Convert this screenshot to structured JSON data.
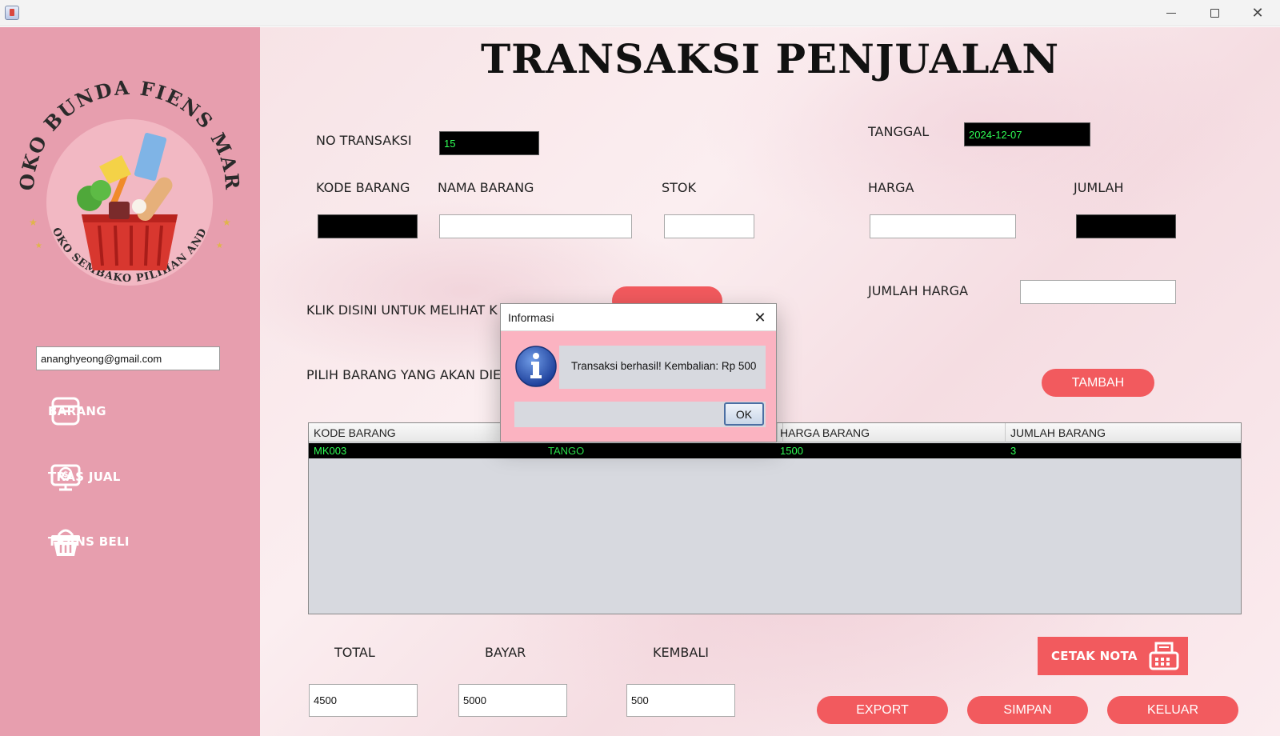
{
  "main": {
    "title": "TRANSAKSI PENJUALAN",
    "labels": {
      "no_transaksi": "NO TRANSAKSI",
      "tanggal": "TANGGAL",
      "kode_barang": "KODE BARANG",
      "nama_barang": "NAMA BARANG",
      "stok": "STOK",
      "harga": "HARGA",
      "jumlah": "JUMLAH",
      "jumlah_harga": "JUMLAH HARGA",
      "klik_disini": "KLIK DISINI UNTUK MELIHAT K",
      "pilih_barang": "PILIH BARANG YANG AKAN DIE",
      "total": "TOTAL",
      "bayar": "BAYAR",
      "kembali": "KEMBALI"
    },
    "fields": {
      "no_transaksi": "15",
      "tanggal": "2024-12-07",
      "kode_barang": "",
      "nama_barang": "",
      "stok": "",
      "harga": "",
      "jumlah": "",
      "jumlah_harga": "",
      "total": "4500",
      "bayar": "5000",
      "kembali": "500"
    },
    "buttons": {
      "tambah": "TAMBAH",
      "cetak_nota": "CETAK NOTA",
      "export": "EXPORT",
      "simpan": "SIMPAN",
      "keluar": "KELUAR"
    },
    "table": {
      "columns": [
        "KODE BARANG",
        "",
        "HARGA BARANG",
        "JUMLAH BARANG"
      ],
      "rows": [
        [
          "MK003",
          "TANGO",
          "1500",
          "3"
        ]
      ]
    }
  },
  "sidebar": {
    "logo_text": {
      "top": "TOKO BUNDA FIENS MART",
      "bottom": "TOKO SEMBAKO PILIHAN ANDA"
    },
    "email": "ananghyeong@gmail.com",
    "items": [
      {
        "label": "BARANG",
        "icon": "archive-box-icon"
      },
      {
        "label": "TRAS JUAL",
        "icon": "cash-register-icon"
      },
      {
        "label": "TRANS BELI",
        "icon": "shopping-basket-icon"
      }
    ]
  },
  "dialog": {
    "title": "Informasi",
    "message": "Transaksi berhasil! Kembalian: Rp 500",
    "ok_label": "OK",
    "icon": "info-icon"
  },
  "colors": {
    "sidebar": "#e79eae",
    "accent_button": "#f25a5e",
    "dark_field": "#000000",
    "dark_field_text": "#2fff55",
    "dialog_bg": "#fbb3c1"
  }
}
